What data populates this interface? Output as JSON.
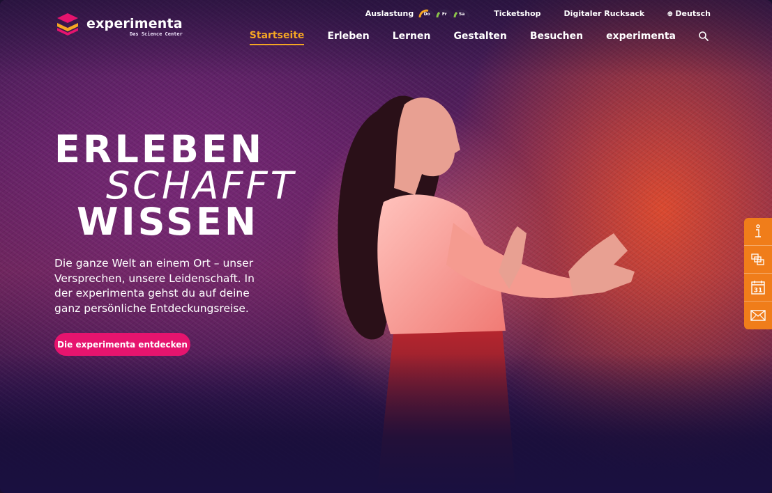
{
  "brand": {
    "name": "experimenta",
    "tagline": "Das Science Center"
  },
  "utility": {
    "load_label": "Auslastung",
    "days": [
      {
        "label": "Do",
        "color": "#f5a623"
      },
      {
        "label": "Fr",
        "color": "#8bc34a"
      },
      {
        "label": "Sa",
        "color": "#8bc34a"
      }
    ],
    "ticketshop": "Ticketshop",
    "backpack": "Digitaler Rucksack",
    "language": "Deutsch"
  },
  "nav": {
    "items": [
      {
        "label": "Startseite",
        "active": true
      },
      {
        "label": "Erleben"
      },
      {
        "label": "Lernen"
      },
      {
        "label": "Gestalten"
      },
      {
        "label": "Besuchen"
      },
      {
        "label": "experimenta"
      }
    ],
    "search_icon": "search-icon"
  },
  "hero": {
    "line1": "ERLEBEN",
    "line2": "SCHAFFT",
    "line3": "WISSEN",
    "lead": "Die ganze Welt an einem Ort – unser Versprechen, unsere Leidenschaft. In der experimenta gehst du auf deine ganz persönliche Entdeckungsreise.",
    "cta": "Die experimenta entdecken"
  },
  "side_tab": {
    "items": [
      {
        "icon": "info-icon"
      },
      {
        "icon": "copy-pages-icon"
      },
      {
        "icon": "calendar-icon",
        "text": "31"
      },
      {
        "icon": "envelope-icon"
      }
    ]
  },
  "colors": {
    "accent": "#f5a623",
    "cta": "#e6146e",
    "side_tab": "#f07d1a"
  }
}
